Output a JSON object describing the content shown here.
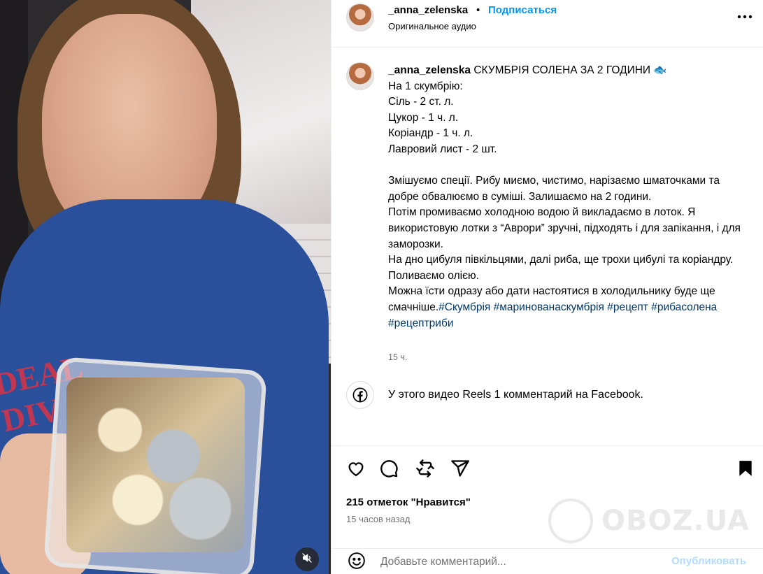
{
  "post": {
    "username": "_anna_zelenska",
    "dot": "•",
    "follow_label": "Подписаться",
    "audio_label": "Оригинальное аудио"
  },
  "caption": {
    "username": "_anna_zelenska",
    "text": " СКУМБРІЯ СОЛЕНА ЗА 2 ГОДИНИ 🐟\nНа 1 скумбрію:\nСіль - 2 ст. л.\nЦукор - 1 ч. л.\nКоріандр - 1 ч. л.\nЛавровий лист - 2 шт.\n\nЗмішуємо спеції. Рибу миємо, чистимо, нарізаємо шматочками та добре обвалюємо в суміші. Залишаємо на 2 години.\nПотім промиваємо холодною водою й викладаємо в лоток. Я використовую лотки з “Аврори” зручні, підходять і для запікання, і для заморозки.\nНа дно цибуля півкільцями, далі риба, ще трохи цибулі та коріандру. Поливаємо олією.\nМожна їсти одразу або дати настоятися в холодильнику буде ще смачніше.",
    "hashtags": "#Скумбрія #маринованаскумбрія #рецепт #рибасолена #рецептриби",
    "time": "15 ч."
  },
  "facebook_notice": "У этого видео Reels 1 комментарий на Facebook.",
  "actions": {
    "likes": "215 отметок \"Нравится\"",
    "posted_ago": "15 часов назад"
  },
  "comment": {
    "placeholder": "Добавьте комментарий...",
    "publish_label": "Опубликовать"
  },
  "watermark": "OBOZ.UA",
  "icons": [
    "mute-icon",
    "more-options-icon",
    "facebook-icon",
    "heart-icon",
    "comment-icon",
    "repost-icon",
    "share-icon",
    "bookmark-icon",
    "emoji-icon"
  ],
  "colors": {
    "link_blue": "#0095f6",
    "hashtag_blue": "#00376b",
    "muted_gray": "#737373",
    "publish_disabled": "#b3dbff"
  }
}
